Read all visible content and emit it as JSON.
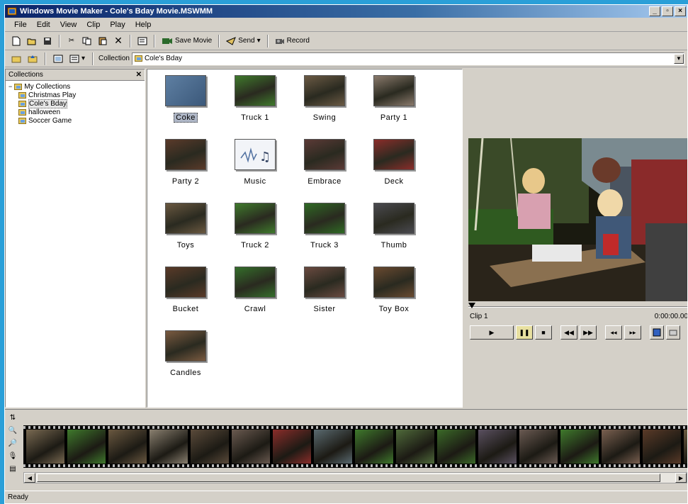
{
  "window": {
    "title": "Windows Movie Maker - Cole's Bday Movie.MSWMM"
  },
  "menu": [
    "File",
    "Edit",
    "View",
    "Clip",
    "Play",
    "Help"
  ],
  "toolbar": {
    "save_movie": "Save Movie",
    "send": "Send",
    "record": "Record"
  },
  "collection_bar": {
    "label": "Collection",
    "value": "Cole's Bday"
  },
  "collections_pane": {
    "header": "Collections",
    "root": "My Collections",
    "items": [
      "Christmas Play",
      "Cole's Bday",
      "halloween",
      "Soccer Game"
    ],
    "selected": "Cole's Bday"
  },
  "clips": [
    {
      "name": "Coke",
      "color": "#4f6d8f"
    },
    {
      "name": "Truck 1",
      "color": "#3f7a2c"
    },
    {
      "name": "Swing",
      "color": "#6b5a44"
    },
    {
      "name": "Party 1",
      "color": "#8a7a6c"
    },
    {
      "name": "Party 2",
      "color": "#5a3a2a"
    },
    {
      "name": "Music",
      "color": "#f2f4f8"
    },
    {
      "name": "Embrace",
      "color": "#5b3a36"
    },
    {
      "name": "Deck",
      "color": "#8b2d2a"
    },
    {
      "name": "Toys",
      "color": "#6a5840"
    },
    {
      "name": "Truck 2",
      "color": "#3f7a2c"
    },
    {
      "name": "Truck 3",
      "color": "#2f6a24"
    },
    {
      "name": "Thumb",
      "color": "#4a4a50"
    },
    {
      "name": "Bucket",
      "color": "#5a3a28"
    },
    {
      "name": "Crawl",
      "color": "#346e2a"
    },
    {
      "name": "Sister",
      "color": "#6a4a40"
    },
    {
      "name": "Toy Box",
      "color": "#6a4a30"
    },
    {
      "name": "Candles",
      "color": "#7a5a40"
    }
  ],
  "selected_clip": "Coke",
  "preview": {
    "clip_name": "Clip 1",
    "time": "0:00:00.00"
  },
  "storyboard_frames": [
    "#7a6a52",
    "#3f7a2c",
    "#6a5840",
    "#8a8070",
    "#5a4a3a",
    "#6a5a50",
    "#8b2d2a",
    "#5a6a70",
    "#3f7a2c",
    "#4f6a3a",
    "#3b6a28",
    "#5a5060",
    "#6a5a52",
    "#3f7a2c",
    "#7a6050",
    "#5a3a28",
    "#6a5a40"
  ],
  "status": "Ready"
}
